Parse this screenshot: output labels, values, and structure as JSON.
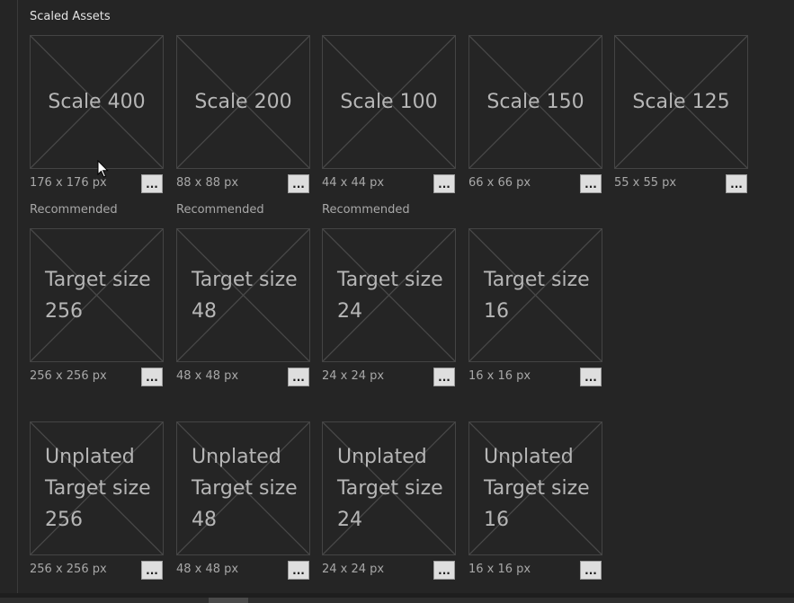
{
  "section": {
    "title": "Scaled Assets"
  },
  "rows": [
    {
      "tiles": [
        {
          "label": [
            "Scale 400"
          ],
          "size": "176 x 176 px",
          "button": "...",
          "note": "Recommended"
        },
        {
          "label": [
            "Scale 200"
          ],
          "size": "88 x 88 px",
          "button": "...",
          "note": "Recommended"
        },
        {
          "label": [
            "Scale 100"
          ],
          "size": "44 x 44 px",
          "button": "...",
          "note": "Recommended"
        },
        {
          "label": [
            "Scale 150"
          ],
          "size": "66 x 66 px",
          "button": "..."
        },
        {
          "label": [
            "Scale 125"
          ],
          "size": "55 x 55 px",
          "button": "..."
        }
      ]
    },
    {
      "tiles": [
        {
          "label": [
            "Target size",
            "256"
          ],
          "size": "256 x 256 px",
          "button": "..."
        },
        {
          "label": [
            "Target size",
            "48"
          ],
          "size": "48 x 48 px",
          "button": "..."
        },
        {
          "label": [
            "Target size",
            "24"
          ],
          "size": "24 x 24 px",
          "button": "..."
        },
        {
          "label": [
            "Target size",
            "16"
          ],
          "size": "16 x 16 px",
          "button": "..."
        }
      ]
    },
    {
      "tiles": [
        {
          "label": [
            "Unplated",
            "Target size",
            "256"
          ],
          "size": "256 x 256 px",
          "button": "..."
        },
        {
          "label": [
            "Unplated",
            "Target size",
            "48"
          ],
          "size": "48 x 48 px",
          "button": "..."
        },
        {
          "label": [
            "Unplated",
            "Target size",
            "24"
          ],
          "size": "24 x 24 px",
          "button": "..."
        },
        {
          "label": [
            "Unplated",
            "Target size",
            "16"
          ],
          "size": "16 x 16 px",
          "button": "..."
        }
      ]
    }
  ],
  "icons": {
    "placeholder": "image-placeholder-cross-icon",
    "cursor": "mouse-pointer-icon"
  },
  "colors": {
    "background": "#252525",
    "tile_border": "#444444",
    "tile_text": "#b6b6b6",
    "button_face": "#dedede"
  }
}
